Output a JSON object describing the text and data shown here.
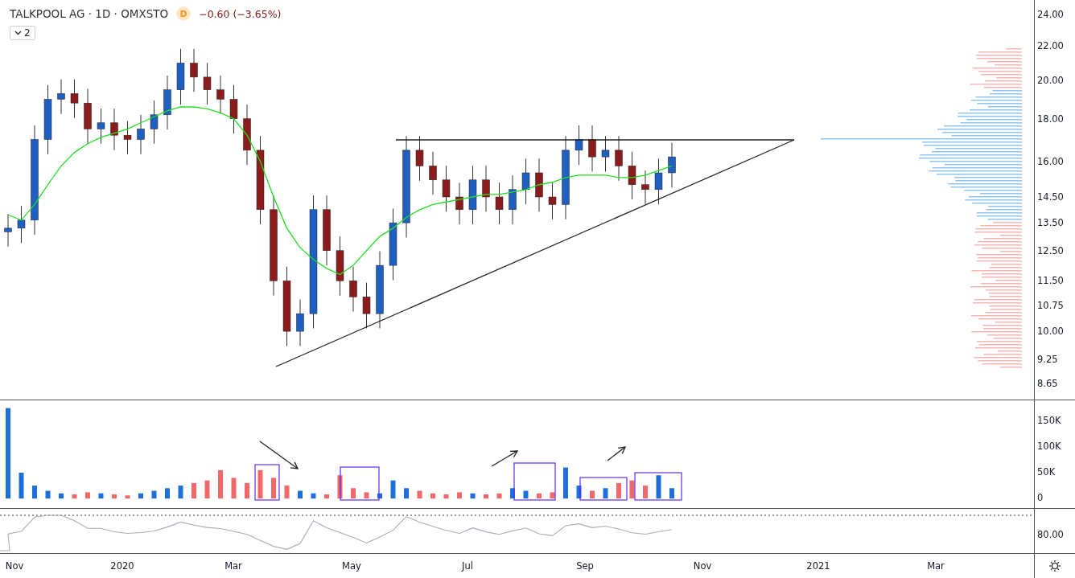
{
  "legend": {
    "title": "TALKPOOL AG · 1D · OMXSTO",
    "badge": "D",
    "change": "−0.60 (−3.65%)",
    "collapse_button": "2"
  },
  "price_axis": [
    "24.00",
    "22.00",
    "20.00",
    "18.00",
    "16.00",
    "14.50",
    "13.50",
    "12.50",
    "11.50",
    "10.75",
    "10.00",
    "9.25",
    "8.65"
  ],
  "volume_axis": [
    "150K",
    "100K",
    "50K",
    "0"
  ],
  "oscillator_axis": [
    "80.00"
  ],
  "time_axis": [
    "Nov",
    "2020",
    "Mar",
    "May",
    "Jul",
    "Sep",
    "Nov",
    "2021",
    "Mar"
  ]
}
